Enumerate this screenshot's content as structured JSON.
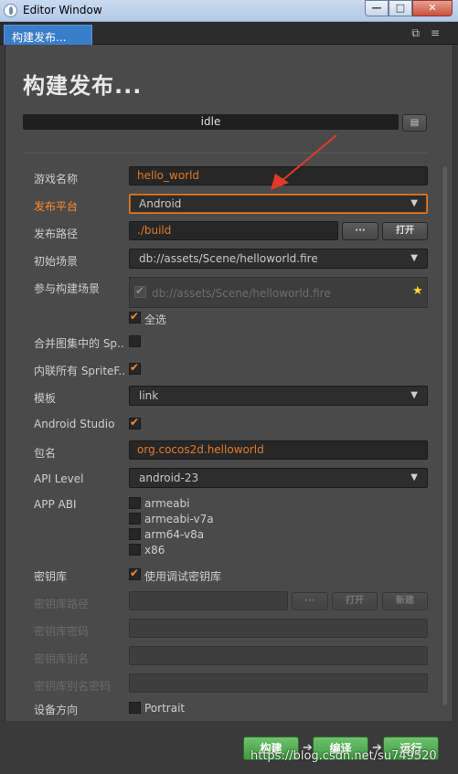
{
  "window": {
    "title": "Editor Window",
    "min_icon": "minimize-icon",
    "max_icon": "maximize-icon",
    "close_icon": "close-icon"
  },
  "tab": {
    "label": "构建发布..."
  },
  "panel": {
    "heading": "构建发布...",
    "status": "idle"
  },
  "fields": {
    "game_name": {
      "label": "游戏名称",
      "value": "hello_world"
    },
    "platform": {
      "label": "发布平台",
      "value": "Android"
    },
    "build_path": {
      "label": "发布路径",
      "value": "./build",
      "browse": "···",
      "open": "打开"
    },
    "start_scene": {
      "label": "初始场景",
      "value": "db://assets/Scene/helloworld.fire"
    },
    "scenes": {
      "label": "参与构建场景",
      "item": "db://assets/Scene/helloworld.fire",
      "select_all": "全选"
    },
    "merge_atlas": {
      "label": "合并图集中的 Sp..",
      "checked": false
    },
    "inline_sprite": {
      "label": "内联所有 SpriteF..",
      "checked": true
    },
    "template": {
      "label": "模板",
      "value": "link"
    },
    "android_studio": {
      "label": "Android Studio",
      "checked": true
    },
    "package": {
      "label": "包名",
      "value": "org.cocos2d.helloworld"
    },
    "api_level": {
      "label": "API Level",
      "value": "android-23"
    },
    "app_abi": {
      "label": "APP ABI",
      "options": [
        "armeabi",
        "armeabi-v7a",
        "arm64-v8a",
        "x86"
      ]
    },
    "keystore": {
      "label": "密钥库",
      "debug_label": "使用调试密钥库",
      "checked": true
    },
    "keystore_path": {
      "label": "密钥库路径",
      "browse": "···",
      "open": "打开",
      "new": "新建"
    },
    "keystore_pwd": {
      "label": "密钥库密码"
    },
    "key_alias": {
      "label": "密钥库别名"
    },
    "key_alias_pwd": {
      "label": "密钥库别名密码"
    },
    "orientation": {
      "label": "设备方向",
      "portrait": "Portrait"
    }
  },
  "actions": {
    "build": "构建",
    "compile": "编译",
    "run": "运行"
  },
  "watermark": "https://blog.csdn.net/su749520",
  "colors": {
    "accent": "#ff8c2a",
    "tab": "#3a7dc9",
    "action_green": "#4fa84f"
  }
}
